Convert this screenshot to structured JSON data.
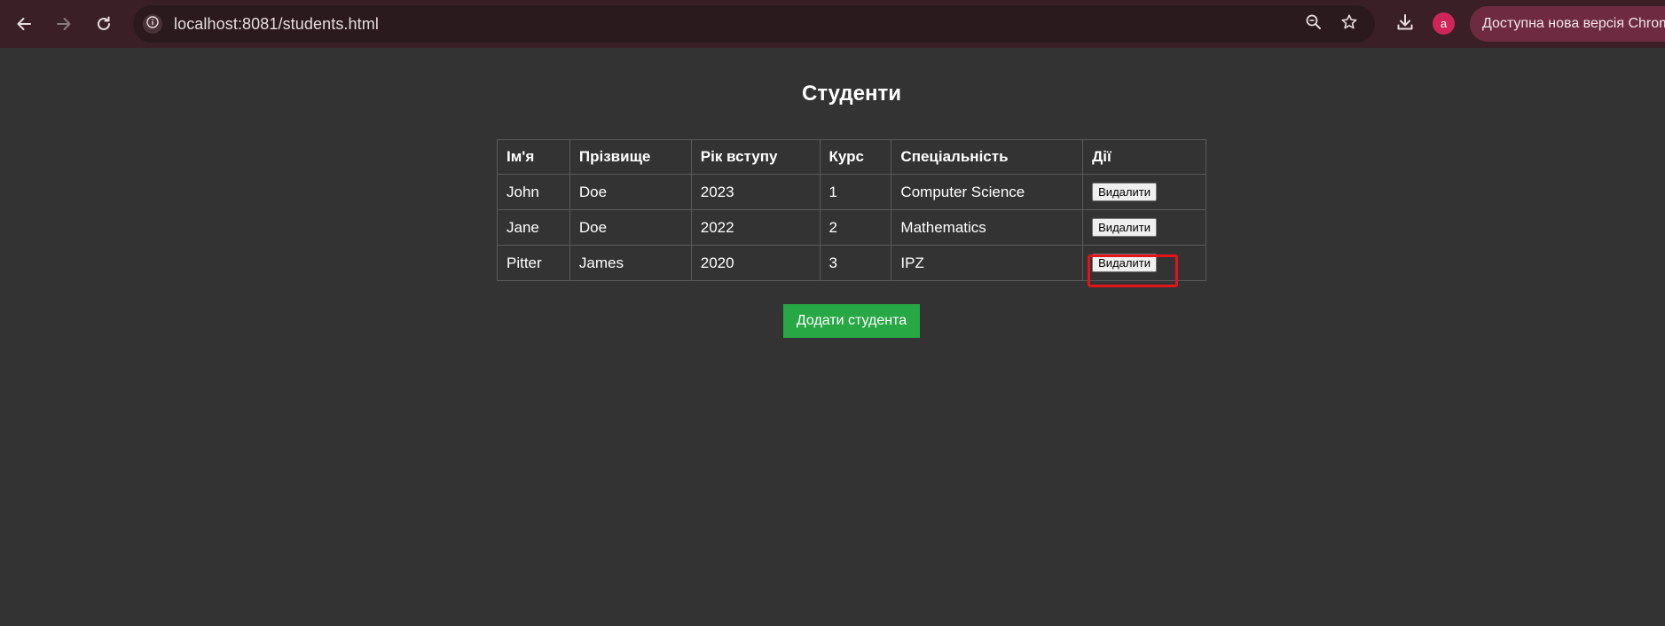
{
  "browser": {
    "url": "localhost:8081/students.html",
    "profile_initial": "a",
    "update_chip_label": "Доступна нова версія Chrome",
    "icons": [
      "back-arrow-icon",
      "forward-arrow-icon",
      "reload-icon",
      "info-icon",
      "zoom-icon",
      "star-icon",
      "download-icon"
    ]
  },
  "page": {
    "title": "Студенти",
    "table": {
      "headers": [
        "Ім'я",
        "Прізвище",
        "Рік вступу",
        "Курс",
        "Спеціальність",
        "Дії"
      ],
      "rows": [
        {
          "first_name": "John",
          "last_name": "Doe",
          "year": "2023",
          "course": "1",
          "specialty": "Computer Science",
          "action": "Видалити"
        },
        {
          "first_name": "Jane",
          "last_name": "Doe",
          "year": "2022",
          "course": "2",
          "specialty": "Mathematics",
          "action": "Видалити"
        },
        {
          "first_name": "Pitter",
          "last_name": "James",
          "year": "2020",
          "course": "3",
          "specialty": "IPZ",
          "action": "Видалити"
        }
      ]
    },
    "add_button_label": "Додати студента"
  },
  "colors": {
    "page_background": "#333333",
    "toolbar_background": "#3a2026",
    "add_button": "#28a745",
    "highlight": "#e3141b"
  }
}
